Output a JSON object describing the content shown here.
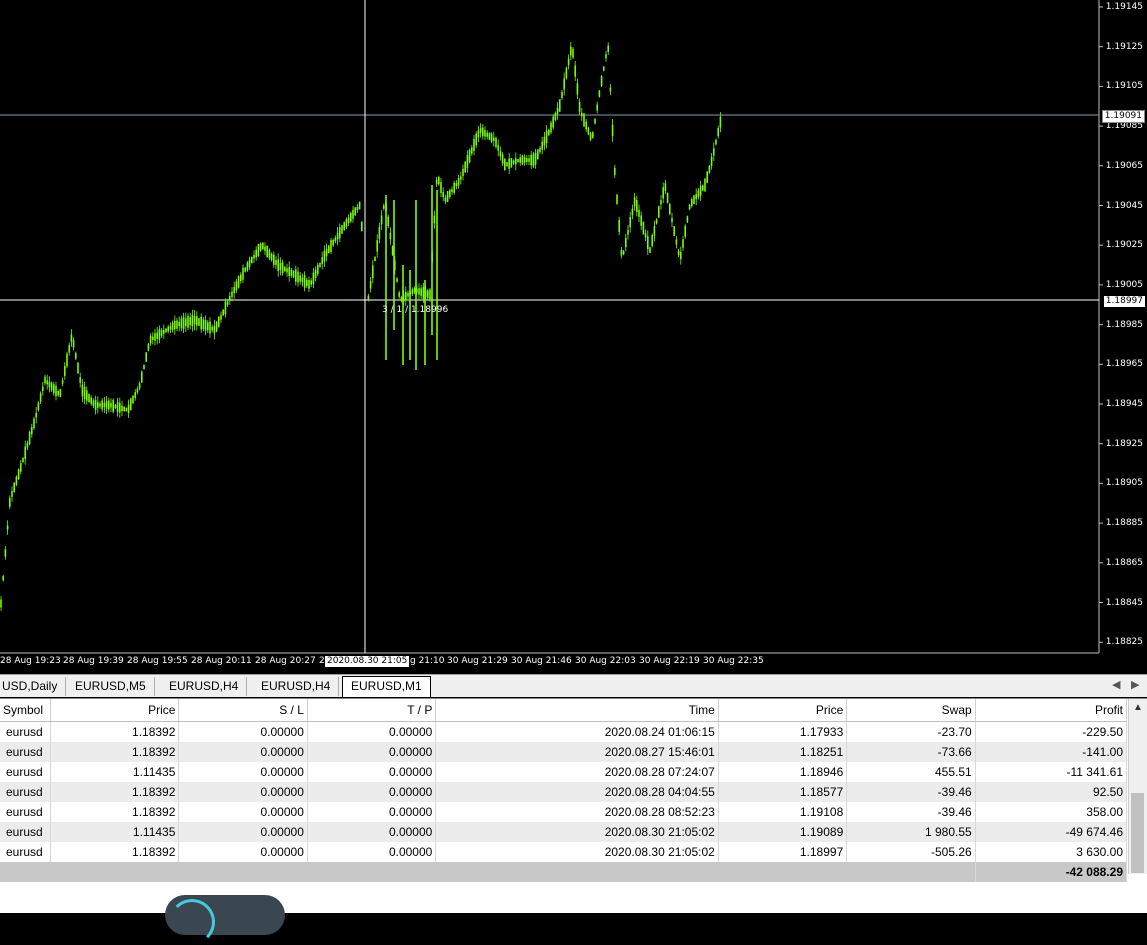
{
  "chart": {
    "symbol_timeframe": "EURUSD,M1",
    "price_axis": [
      "1.19145",
      "1.19125",
      "1.19105",
      "1.19085",
      "1.19065",
      "1.19045",
      "1.19025",
      "1.19005",
      "1.18985",
      "1.18965",
      "1.18945",
      "1.18925",
      "1.18905",
      "1.18885",
      "1.18865",
      "1.18845",
      "1.18825"
    ],
    "time_axis": [
      "28 Aug 19:23",
      "28 Aug 19:39",
      "28 Aug 19:55",
      "28 Aug 20:11",
      "28 Aug 20:27",
      "2",
      "g 21:10",
      "30 Aug 21:29",
      "30 Aug 21:46",
      "30 Aug 22:03",
      "30 Aug 22:19",
      "30 Aug 22:35"
    ],
    "bid_line_tag": "1.19091",
    "crosshair_price_tag": "1.18997",
    "crosshair_time_tag": "2020.08.30 21:05",
    "crosshair_readout": "3 / 1 / 1.18996",
    "colors": {
      "background": "#000000",
      "candles": "#7CFC00",
      "grid_lines": "#c0c0c0"
    }
  },
  "tabs": {
    "items": [
      {
        "label": "USD,Daily"
      },
      {
        "label": "EURUSD,M5"
      },
      {
        "label": "EURUSD,H4"
      },
      {
        "label": "EURUSD,H4"
      },
      {
        "label": "EURUSD,M1",
        "active": true
      }
    ],
    "left_arrow": "◀",
    "right_arrow": "▶"
  },
  "terminal": {
    "headers": [
      "Symbol",
      "Price",
      "S / L",
      "T / P",
      "Time",
      "Price",
      "Swap",
      "Profit"
    ],
    "rows": [
      [
        "eurusd",
        "1.18392",
        "0.00000",
        "0.00000",
        "2020.08.24 01:06:15",
        "1.17933",
        "-23.70",
        "-229.50"
      ],
      [
        "eurusd",
        "1.18392",
        "0.00000",
        "0.00000",
        "2020.08.27 15:46:01",
        "1.18251",
        "-73.66",
        "-141.00"
      ],
      [
        "eurusd",
        "1.11435",
        "0.00000",
        "0.00000",
        "2020.08.28 07:24:07",
        "1.18946",
        "455.51",
        "-11 341.61"
      ],
      [
        "eurusd",
        "1.18392",
        "0.00000",
        "0.00000",
        "2020.08.28 04:04:55",
        "1.18577",
        "-39.46",
        "92.50"
      ],
      [
        "eurusd",
        "1.18392",
        "0.00000",
        "0.00000",
        "2020.08.28 08:52:23",
        "1.19108",
        "-39.46",
        "358.00"
      ],
      [
        "eurusd",
        "1.11435",
        "0.00000",
        "0.00000",
        "2020.08.30 21:05:02",
        "1.19089",
        "1 980.55",
        "-49 674.46"
      ],
      [
        "eurusd",
        "1.18392",
        "0.00000",
        "0.00000",
        "2020.08.30 21:05:02",
        "1.18997",
        "-505.26",
        "3 630.00"
      ]
    ],
    "total_profit": "-42 088.29"
  }
}
